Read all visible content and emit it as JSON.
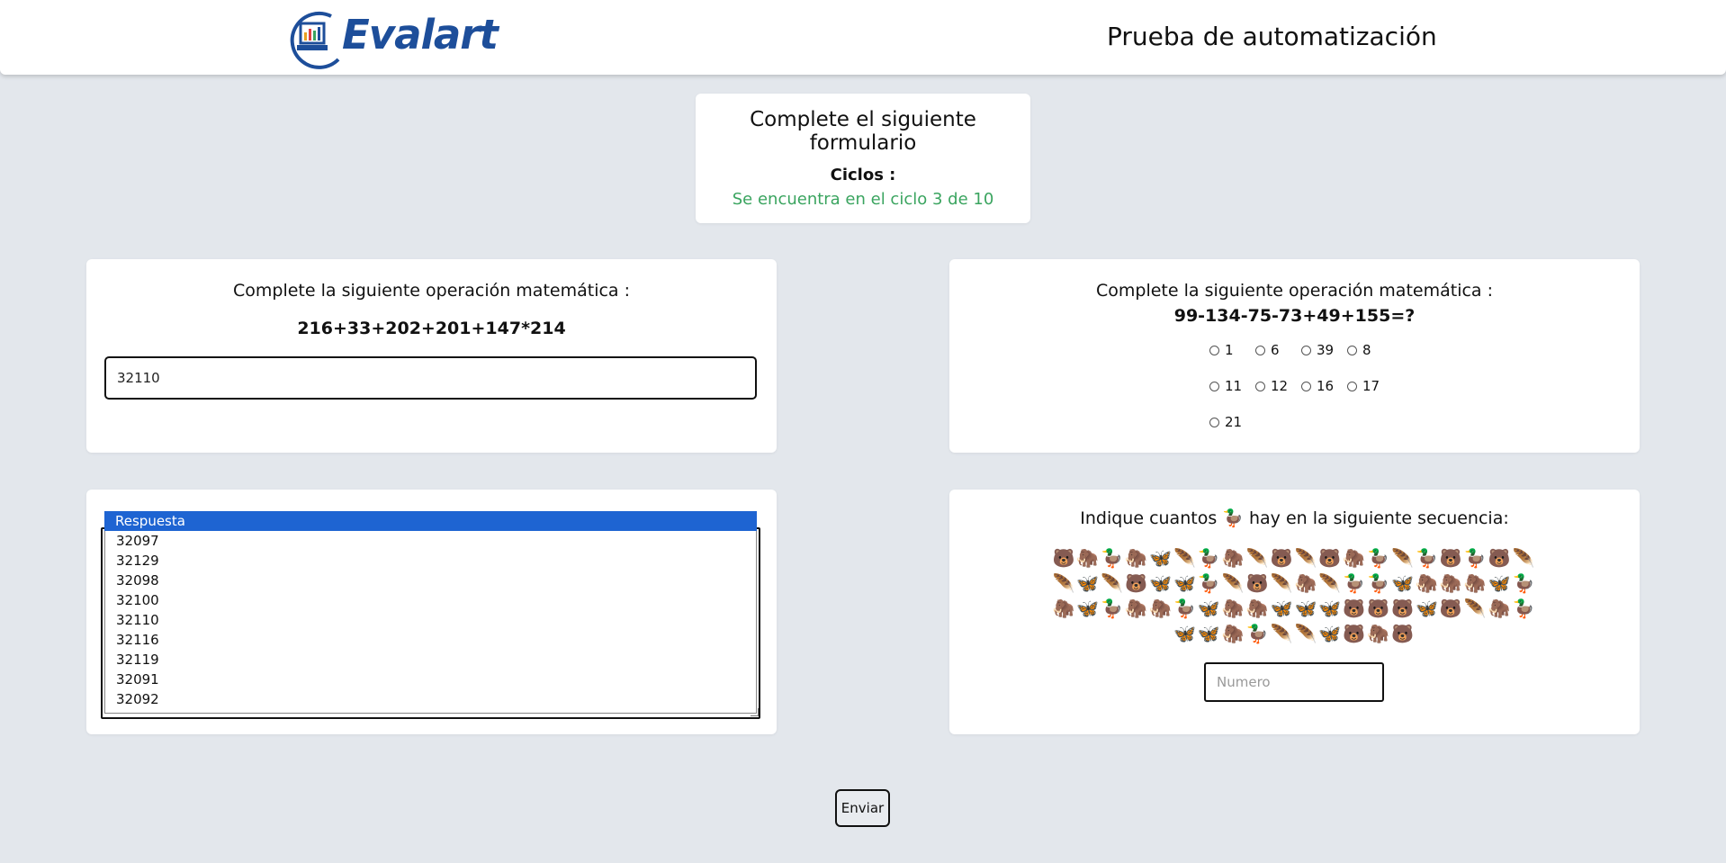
{
  "header": {
    "logo_text": "Evalart",
    "title": "Prueba de automatización"
  },
  "intro": {
    "title": "Complete el siguiente formulario",
    "cycles_label": "Ciclos :",
    "cycle_status": "Se encuentra en el ciclo 3 de 10"
  },
  "q1": {
    "label": "Complete la siguiente operación matemática :",
    "expression": "216+33+202+201+147*214",
    "answer_value": "32110"
  },
  "q2": {
    "label": "Complete la siguiente operación matemática :",
    "expression": "99-134-75-73+49+155=?",
    "options": [
      "1",
      "6",
      "39",
      "8",
      "11",
      "12",
      "16",
      "17",
      "21"
    ]
  },
  "q3": {
    "select_header": "Respuesta",
    "options": [
      "32097",
      "32129",
      "32098",
      "32100",
      "32110",
      "32116",
      "32119",
      "32091",
      "32092"
    ]
  },
  "q4": {
    "label_before": "Indique cuantos",
    "target_emoji": "🦆",
    "label_after": "hay en la siguiente secuencia:",
    "sequence_rows": [
      "🐻🦣🦆🦣🦋🪶🦆🦣🪶🐻🪶🐻🦣🦆🪶🦆🐻🦆🐻🪶",
      "🪶🦋🪶🐻🦋🦋🦆🪶🐻🪶🦣🪶🦆🦆🦋🦣🦣🦣🦋🦆",
      "🦣🦋🦆🦣🦣🦆🦋🦣🦣🦋🦋🦋🐻🐻🐻🦋🐻🪶🦣🦆",
      "🦋🦋🦣🦆🪶🪶🦋🐻🦣🐻"
    ],
    "input_placeholder": "Numero"
  },
  "submit_label": "Enviar",
  "colors": {
    "background": "#e3e7ec",
    "brand_blue": "#1d4e9a",
    "status_green": "#3aa45f",
    "select_highlight": "#1e64d2"
  }
}
